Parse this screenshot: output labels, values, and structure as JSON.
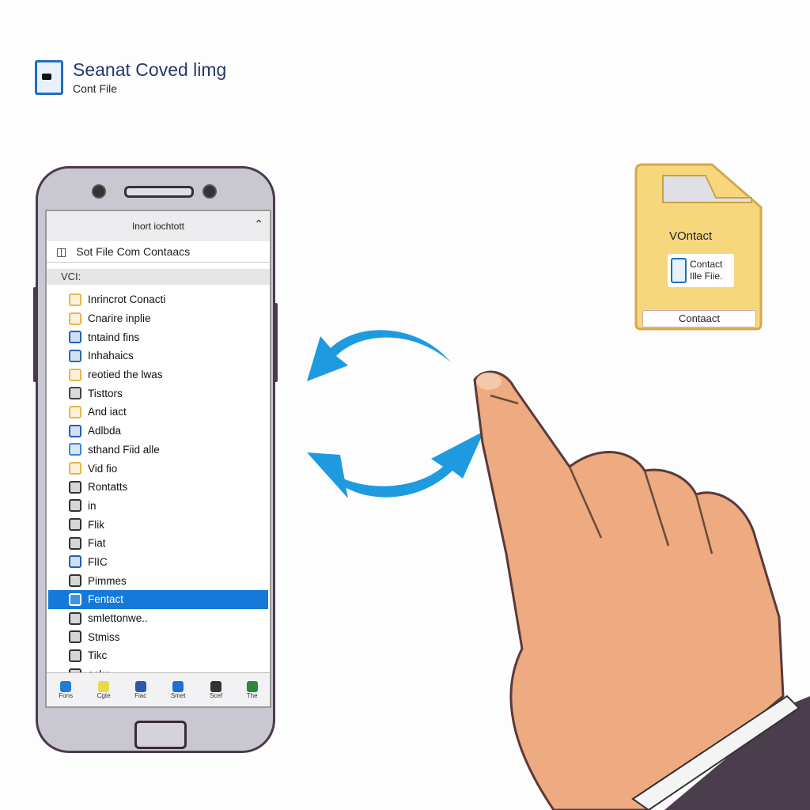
{
  "header": {
    "title": "Seanat Coved limg",
    "subtitle": "Cont File",
    "icon": "contact-file-icon"
  },
  "phone": {
    "topbar_title": "Inort iochtott",
    "search_label": "Sot File Com Contaacs",
    "section_label": "VCI:",
    "items": [
      {
        "label": "Inrincrot Conacti",
        "icon": "person-icon",
        "color": "#e8b64a"
      },
      {
        "label": "Cnarire inplie",
        "icon": "contact-card-icon",
        "color": "#e8b64a"
      },
      {
        "label": "tntaind fins",
        "icon": "file-icon",
        "color": "#1f5fb8"
      },
      {
        "label": "Inhahaics",
        "icon": "image-icon",
        "color": "#2a6ab5"
      },
      {
        "label": "reotied the lwas",
        "icon": "person-icon",
        "color": "#e8b64a"
      },
      {
        "label": "Tisttors",
        "icon": "document-icon",
        "color": "#444444"
      },
      {
        "label": "And iact",
        "icon": "briefcase-icon",
        "color": "#e8b64a"
      },
      {
        "label": "Adlbda",
        "icon": "book-icon",
        "color": "#1f5fb8"
      },
      {
        "label": "sthand Fiid alle",
        "icon": "list-icon",
        "color": "#3d86d6"
      },
      {
        "label": "Vid fio",
        "icon": "folder-icon",
        "color": "#e8b64a"
      },
      {
        "label": "Rontatts",
        "icon": "edit-icon",
        "color": "#333333"
      },
      {
        "label": "in",
        "icon": "user-icon",
        "color": "#333333"
      },
      {
        "label": "Flik",
        "icon": "home-icon",
        "color": "#333333"
      },
      {
        "label": "Fiat",
        "icon": "printer-icon",
        "color": "#333333"
      },
      {
        "label": "FlIC",
        "icon": "image-icon",
        "color": "#1f5fb8"
      },
      {
        "label": "Pimmes",
        "icon": "frame-icon",
        "color": "#333333"
      },
      {
        "label": "Fentact",
        "icon": "contact-icon",
        "color": "#ffffff",
        "selected": true
      },
      {
        "label": "smlettonwe..",
        "icon": "printer-icon",
        "color": "#333333"
      },
      {
        "label": "Stmiss",
        "icon": "box-icon",
        "color": "#333333"
      },
      {
        "label": "Tikc",
        "icon": "lock-icon",
        "color": "#333333"
      },
      {
        "label": "acke",
        "icon": "search-icon",
        "color": "#333333"
      }
    ],
    "bottom_nav": [
      {
        "label": "Fons",
        "icon": "contacts-icon",
        "color": "#1f7fd8"
      },
      {
        "label": "Cgte",
        "icon": "message-icon",
        "color": "#e8d84a"
      },
      {
        "label": "Fiac",
        "icon": "image-icon",
        "color": "#2a5aa8"
      },
      {
        "label": "Smet",
        "icon": "phone-icon",
        "color": "#1f6fd0"
      },
      {
        "label": "Scef",
        "icon": "file-icon",
        "color": "#333333"
      },
      {
        "label": "The",
        "icon": "share-icon",
        "color": "#2a8a3a"
      }
    ]
  },
  "folder": {
    "title": "VOntact",
    "card_line1": "Contact",
    "card_line2": "Ille Fiie.",
    "button": "Contaact",
    "color": "#f7d77e"
  },
  "colors": {
    "arrow": "#1e9be0",
    "selected": "#1479d9",
    "skin": "#eeaa80",
    "sleeve": "#4a3d4c"
  }
}
